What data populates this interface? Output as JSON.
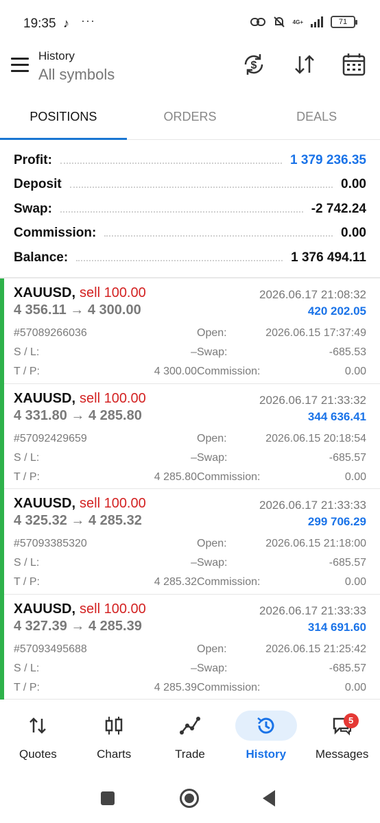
{
  "status_bar": {
    "time": "19:35",
    "tiktok_glyph": "♪",
    "dots": "···",
    "network": "4G+",
    "battery": "71"
  },
  "header": {
    "title": "History",
    "subtitle": "All symbols",
    "icons": [
      "menu-icon",
      "currency-sync-icon",
      "sort-icon",
      "calendar-icon"
    ]
  },
  "tabs": [
    {
      "label": "POSITIONS",
      "active": true
    },
    {
      "label": "ORDERS",
      "active": false
    },
    {
      "label": "DEALS",
      "active": false
    }
  ],
  "summary": [
    {
      "label": "Profit:",
      "value": "1 379 236.35",
      "highlight": true
    },
    {
      "label": "Deposit",
      "value": "0.00",
      "highlight": false
    },
    {
      "label": "Swap:",
      "value": "-2 742.24",
      "highlight": false
    },
    {
      "label": "Commission:",
      "value": "0.00",
      "highlight": false
    },
    {
      "label": "Balance:",
      "value": "1 376 494.11",
      "highlight": false
    }
  ],
  "positions": [
    {
      "symbol": "XAUUSD,",
      "side": "sell 100.00",
      "prices": "4 356.11 → 4 300.00",
      "close_time": "2026.06.17 21:08:32",
      "profit": "420 202.05",
      "ticket": "#57089266036",
      "open_label": "Open:",
      "open_time": "2026.06.15 17:37:49",
      "sl_label": "S / L:",
      "sl": "–",
      "swap_label": "Swap:",
      "swap": "-685.53",
      "tp_label": "T / P:",
      "tp": "4 300.00",
      "commission_label": "Commission:",
      "commission": "0.00"
    },
    {
      "symbol": "XAUUSD,",
      "side": "sell 100.00",
      "prices": "4 331.80 → 4 285.80",
      "close_time": "2026.06.17 21:33:32",
      "profit": "344 636.41",
      "ticket": "#57092429659",
      "open_label": "Open:",
      "open_time": "2026.06.15 20:18:54",
      "sl_label": "S / L:",
      "sl": "–",
      "swap_label": "Swap:",
      "swap": "-685.57",
      "tp_label": "T / P:",
      "tp": "4 285.80",
      "commission_label": "Commission:",
      "commission": "0.00"
    },
    {
      "symbol": "XAUUSD,",
      "side": "sell 100.00",
      "prices": "4 325.32 → 4 285.32",
      "close_time": "2026.06.17 21:33:33",
      "profit": "299 706.29",
      "ticket": "#57093385320",
      "open_label": "Open:",
      "open_time": "2026.06.15 21:18:00",
      "sl_label": "S / L:",
      "sl": "–",
      "swap_label": "Swap:",
      "swap": "-685.57",
      "tp_label": "T / P:",
      "tp": "4 285.32",
      "commission_label": "Commission:",
      "commission": "0.00"
    },
    {
      "symbol": "XAUUSD,",
      "side": "sell 100.00",
      "prices": "4 327.39 → 4 285.39",
      "close_time": "2026.06.17 21:33:33",
      "profit": "314 691.60",
      "ticket": "#57093495688",
      "open_label": "Open:",
      "open_time": "2026.06.15 21:25:42",
      "sl_label": "S / L:",
      "sl": "–",
      "swap_label": "Swap:",
      "swap": "-685.57",
      "tp_label": "T / P:",
      "tp": "4 285.39",
      "commission_label": "Commission:",
      "commission": "0.00"
    }
  ],
  "bottom_nav": [
    {
      "label": "Quotes",
      "icon": "quotes-arrows-icon",
      "active": false
    },
    {
      "label": "Charts",
      "icon": "candlestick-icon",
      "active": false
    },
    {
      "label": "Trade",
      "icon": "trade-line-icon",
      "active": false
    },
    {
      "label": "History",
      "icon": "history-clock-icon",
      "active": true
    },
    {
      "label": "Messages",
      "icon": "messages-icon",
      "active": false,
      "badge": "5"
    }
  ],
  "colors": {
    "accent": "#1a73e8",
    "sell": "#d32222",
    "position_bar": "#2eb24a",
    "nav_pill": "#e3effc",
    "badge": "#e53935"
  }
}
